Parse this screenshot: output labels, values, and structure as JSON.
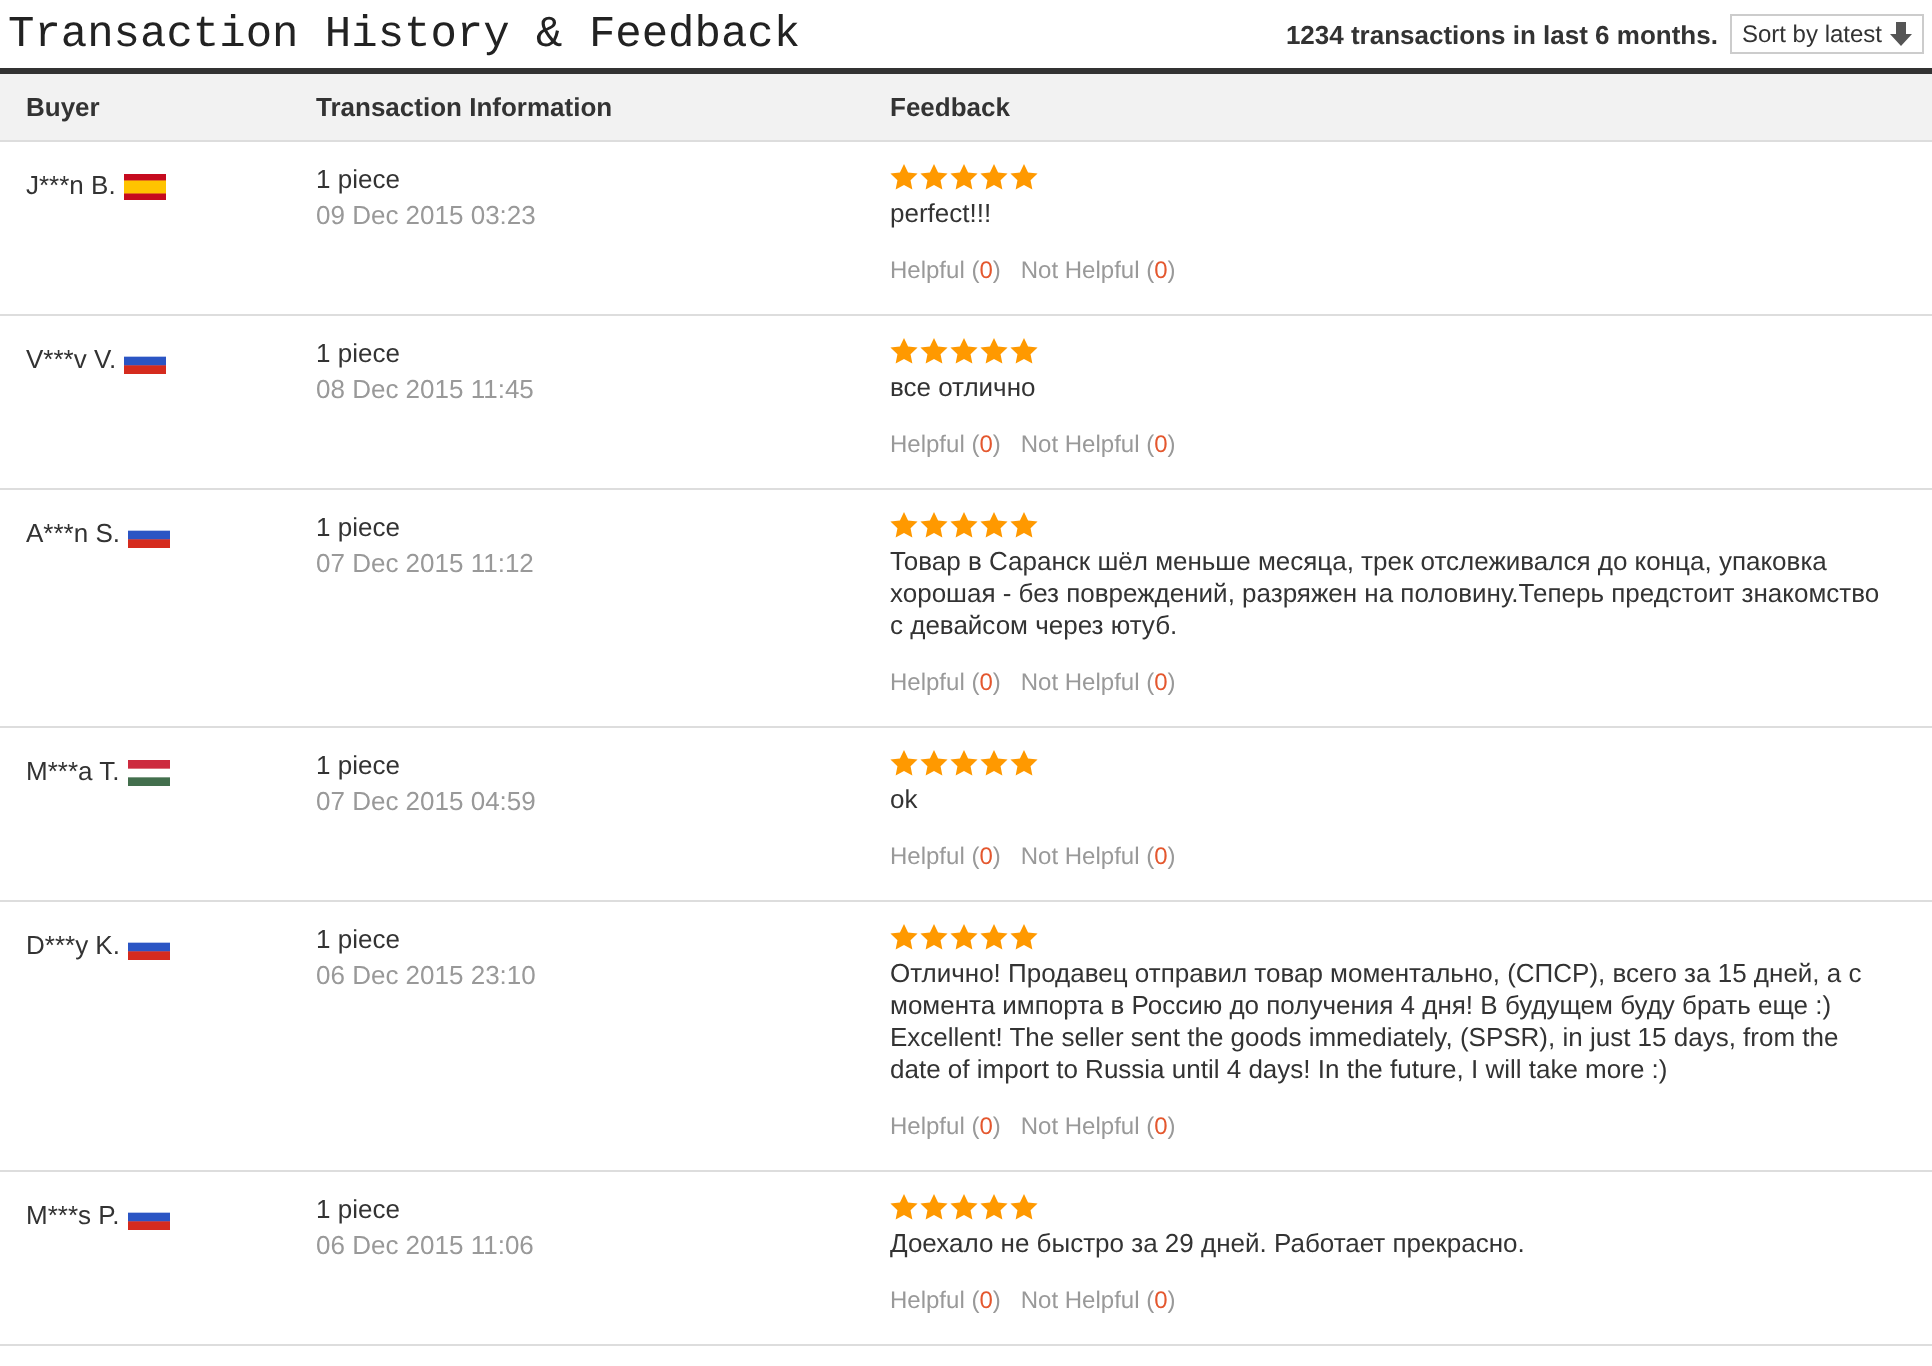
{
  "title": "Transaction History & Feedback",
  "summary": {
    "count": "1234",
    "text": "transactions in last 6 months."
  },
  "sort_button": "Sort by latest",
  "table": {
    "columns": [
      "Buyer",
      "Transaction Information",
      "Feedback"
    ],
    "rows": [
      {
        "buyer": "J***n B.",
        "kind": "spain",
        "quantity": "1 piece",
        "date": "09 Dec 2015 03:23",
        "stars": 5,
        "comment": "perfect!!!",
        "helpful": {
          "label": "Helpful (",
          "count": "0",
          "end": ")"
        },
        "not_helpful": {
          "label": "Not Helpful (",
          "count": "0",
          "end": ")"
        }
      },
      {
        "buyer": "V***v V.",
        "kind": "russia",
        "quantity": "1 piece",
        "date": "08 Dec 2015 11:45",
        "stars": 5,
        "comment": "все отлично",
        "helpful": {
          "label": "Helpful (",
          "count": "0",
          "end": ")"
        },
        "not_helpful": {
          "label": "Not Helpful (",
          "count": "0",
          "end": ")"
        }
      },
      {
        "buyer": "A***n S.",
        "kind": "russia",
        "quantity": "1 piece",
        "date": "07 Dec 2015 11:12",
        "stars": 5,
        "comment": "Товар в Саранск шёл меньше месяца, трек отслеживался до конца, упаковка хорошая - без повреждений, разряжен на половину.Теперь предстоит знакомство с девайсом через ютуб.",
        "helpful": {
          "label": "Helpful (",
          "count": "0",
          "end": ")"
        },
        "not_helpful": {
          "label": "Not Helpful (",
          "count": "0",
          "end": ")"
        }
      },
      {
        "buyer": "M***a T.",
        "kind": "hungary",
        "quantity": "1 piece",
        "date": "07 Dec 2015 04:59",
        "stars": 5,
        "comment": "ok",
        "helpful": {
          "label": "Helpful (",
          "count": "0",
          "end": ")"
        },
        "not_helpful": {
          "label": "Not Helpful (",
          "count": "0",
          "end": ")"
        }
      },
      {
        "buyer": "D***y K.",
        "kind": "russia",
        "quantity": "1 piece",
        "date": "06 Dec 2015 23:10",
        "stars": 5,
        "comment": "Отлично! Продавец отправил товар моментально, (СПСР), всего за 15 дней, а с момента импорта в Россию до получения 4 дня! В будущем буду брать еще :) Excellent! The seller sent the goods immediately, (SPSR), in just 15 days, from the date of import to Russia until 4 days! In the future, I will take more :)",
        "helpful": {
          "label": "Helpful (",
          "count": "0",
          "end": ")"
        },
        "not_helpful": {
          "label": "Not Helpful (",
          "count": "0",
          "end": ")"
        }
      },
      {
        "buyer": "M***s P.",
        "kind": "russia",
        "quantity": "1 piece",
        "date": "06 Dec 2015 11:06",
        "stars": 5,
        "comment": "Доехало не быстро за 29 дней. Работает прекрасно.",
        "helpful": {
          "label": "Helpful (",
          "count": "0",
          "end": ")"
        },
        "not_helpful": {
          "label": "Not Helpful (",
          "count": "0",
          "end": ")"
        }
      }
    ]
  }
}
